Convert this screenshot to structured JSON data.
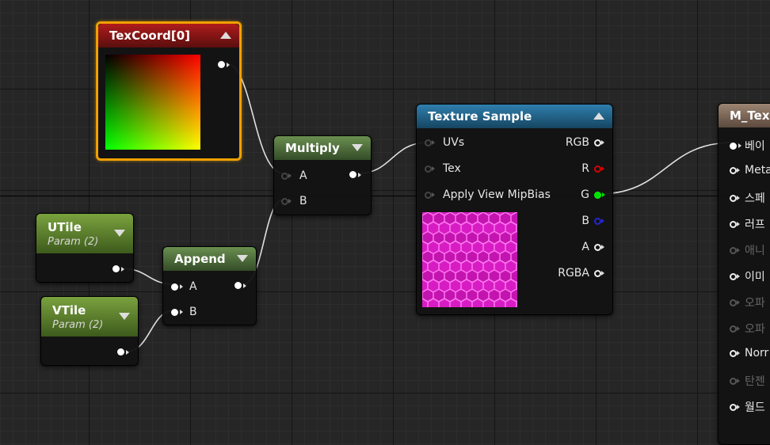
{
  "nodes": {
    "texcoord": {
      "title": "TexCoord[0]"
    },
    "multiply": {
      "title": "Multiply",
      "inputs": [
        "A",
        "B"
      ]
    },
    "utile": {
      "title": "UTile",
      "subtitle": "Param (2)"
    },
    "vtile": {
      "title": "VTile",
      "subtitle": "Param (2)"
    },
    "append": {
      "title": "Append",
      "inputs": [
        "A",
        "B"
      ]
    },
    "texture_sample": {
      "title": "Texture Sample",
      "inputs": [
        "UVs",
        "Tex",
        "Apply View MipBias"
      ],
      "outputs": [
        "RGB",
        "R",
        "G",
        "B",
        "A",
        "RGBA"
      ]
    },
    "material": {
      "title": "M_Tex",
      "inputs": [
        "베이",
        "Meta",
        "스페",
        "러프",
        "애니",
        "이미",
        "오파",
        "오파",
        "Norr",
        "탄젠",
        "월드"
      ]
    }
  },
  "colors": {
    "selection_outline": "#f0a000",
    "wire": "#e0e0e0",
    "pin_r": "#dd0000",
    "pin_g": "#00e000",
    "pin_b": "#2424d8",
    "texture_magenta": "#e020d0"
  }
}
